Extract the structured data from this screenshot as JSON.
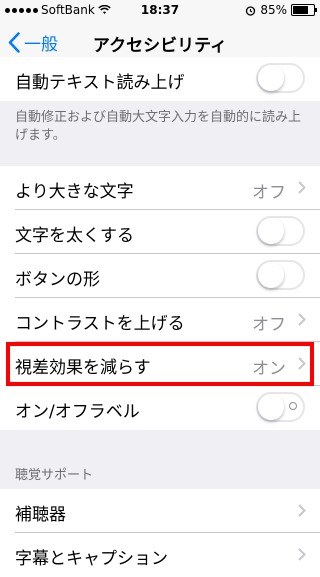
{
  "status_bar": {
    "carrier": "SoftBank",
    "time": "18:37",
    "battery_percent": "85%",
    "battery_level": 0.85
  },
  "nav": {
    "back_label": "一般",
    "title": "アクセシビリティ"
  },
  "rows": {
    "auto_speak_text": {
      "label": "自動テキスト読み上げ",
      "on": false
    },
    "footer_note": "自動修正および自動大文字入力を自動的に読み上げます。",
    "larger_text": {
      "label": "より大きな文字",
      "value": "オフ"
    },
    "bold_text": {
      "label": "文字を太くする",
      "on": false
    },
    "button_shapes": {
      "label": "ボタンの形",
      "on": false
    },
    "increase_contrast": {
      "label": "コントラストを上げる",
      "value": "オフ"
    },
    "reduce_motion": {
      "label": "視差効果を減らす",
      "value": "オン"
    },
    "on_off_labels": {
      "label": "オン/オフラベル",
      "on": false
    }
  },
  "hearing_section": {
    "header": "聴覚サポート",
    "hearing_aids": {
      "label": "補聴器"
    },
    "subtitles": {
      "label": "字幕とキャプション"
    }
  },
  "colors": {
    "accent": "#007aff",
    "highlight": "#ff0000"
  }
}
